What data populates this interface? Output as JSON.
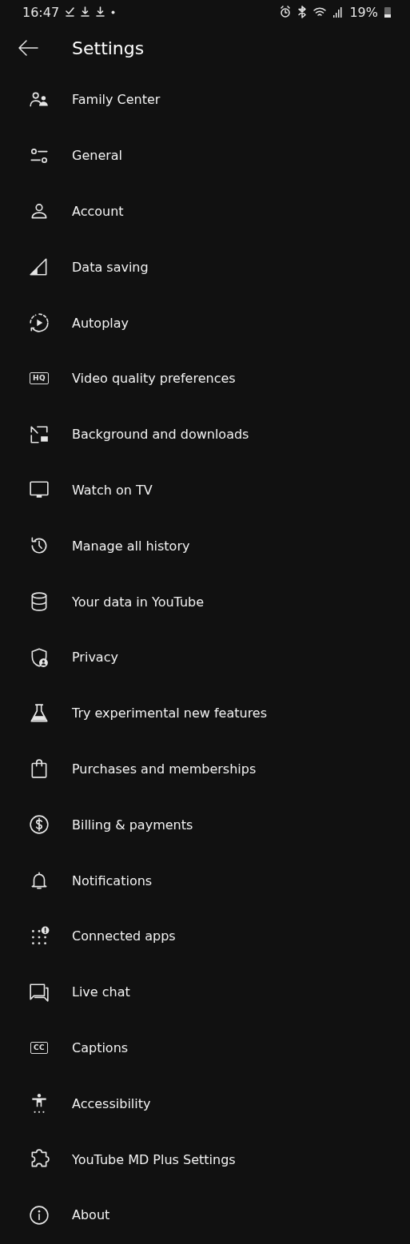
{
  "status_bar": {
    "time": "16:47",
    "battery": "19%"
  },
  "header": {
    "title": "Settings"
  },
  "items": [
    {
      "label": "Family Center"
    },
    {
      "label": "General"
    },
    {
      "label": "Account"
    },
    {
      "label": "Data saving"
    },
    {
      "label": "Autoplay"
    },
    {
      "label": "Video quality preferences",
      "badge": "HQ"
    },
    {
      "label": "Background and downloads"
    },
    {
      "label": "Watch on TV"
    },
    {
      "label": "Manage all history"
    },
    {
      "label": "Your data in YouTube"
    },
    {
      "label": "Privacy"
    },
    {
      "label": "Try experimental new features"
    },
    {
      "label": "Purchases and memberships"
    },
    {
      "label": "Billing & payments"
    },
    {
      "label": "Notifications"
    },
    {
      "label": "Connected apps"
    },
    {
      "label": "Live chat"
    },
    {
      "label": "Captions",
      "badge": "CC"
    },
    {
      "label": "Accessibility"
    },
    {
      "label": "YouTube MD Plus Settings"
    },
    {
      "label": "About"
    }
  ]
}
